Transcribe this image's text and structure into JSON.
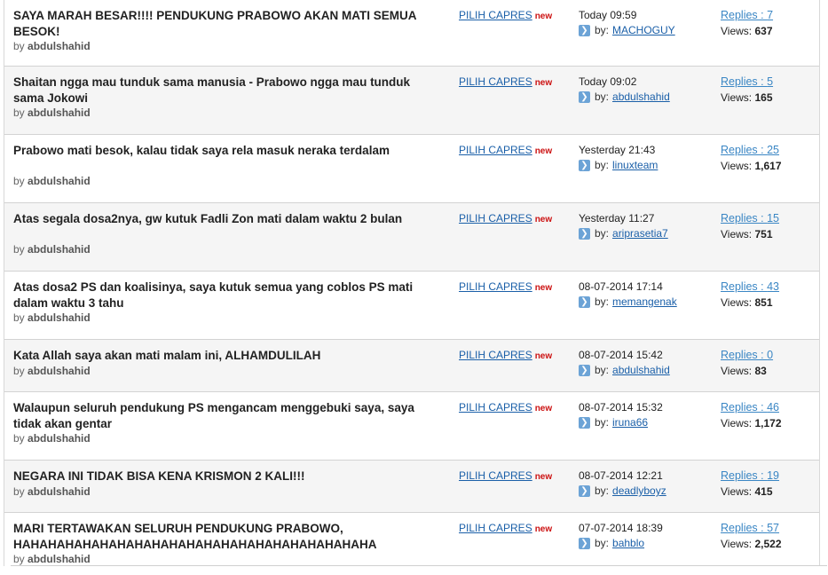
{
  "labels": {
    "by": "by",
    "by_colon": "by:",
    "replies_prefix": "Replies : ",
    "views_prefix": "Views: ",
    "new_badge": "new"
  },
  "threads": [
    {
      "title": "SAYA MARAH BESAR!!!! PENDUKUNG PRABOWO AKAN MATI SEMUA BESOK!",
      "author": "abdulshahid",
      "category": "PILIH CAPRES",
      "date": "Today 09:59",
      "last_poster": "MACHOGUY",
      "replies": "7",
      "views": "637"
    },
    {
      "title": "Shaitan ngga mau tunduk sama manusia - Prabowo ngga mau tunduk sama Jokowi",
      "author": "abdulshahid",
      "category": "PILIH CAPRES",
      "date": "Today 09:02",
      "last_poster": "abdulshahid",
      "replies": "5",
      "views": "165"
    },
    {
      "title": "Prabowo mati besok, kalau tidak saya rela masuk neraka terdalam",
      "author": "abdulshahid",
      "category": "PILIH CAPRES",
      "date": "Yesterday 21:43",
      "last_poster": "linuxteam",
      "replies": "25",
      "views": "1,617"
    },
    {
      "title": "Atas segala dosa2nya, gw kutuk Fadli Zon mati dalam waktu 2 bulan",
      "author": "abdulshahid",
      "category": "PILIH CAPRES",
      "date": "Yesterday 11:27",
      "last_poster": "ariprasetia7",
      "replies": "15",
      "views": "751"
    },
    {
      "title": "Atas dosa2 PS dan koalisinya, saya kutuk semua yang coblos PS mati dalam waktu 3 tahu",
      "author": "abdulshahid",
      "category": "PILIH CAPRES",
      "date": "08-07-2014 17:14",
      "last_poster": "memangenak",
      "replies": "43",
      "views": "851"
    },
    {
      "title": "Kata Allah saya akan mati malam ini, ALHAMDULILAH",
      "author": "abdulshahid",
      "category": "PILIH CAPRES",
      "date": "08-07-2014 15:42",
      "last_poster": "abdulshahid",
      "replies": "0",
      "views": "83"
    },
    {
      "title": "Walaupun seluruh pendukung PS mengancam menggebuki saya, saya tidak akan gentar",
      "author": "abdulshahid",
      "category": "PILIH CAPRES",
      "date": "08-07-2014 15:32",
      "last_poster": "iruna66",
      "replies": "46",
      "views": "1,172"
    },
    {
      "title": "NEGARA INI TIDAK BISA KENA KRISMON 2 KALI!!!",
      "author": "abdulshahid",
      "category": "PILIH CAPRES",
      "date": "08-07-2014 12:21",
      "last_poster": "deadlyboyz",
      "replies": "19",
      "views": "415"
    },
    {
      "title": "MARI TERTAWAKAN SELURUH PENDUKUNG PRABOWO, HAHAHAHAHAHAHAHAHAHAHAHAHAHAHAHAHAHAHAHAHA",
      "author": "abdulshahid",
      "category": "PILIH CAPRES",
      "date": "07-07-2014 18:39",
      "last_poster": "bahblo",
      "replies": "57",
      "views": "2,522"
    }
  ]
}
